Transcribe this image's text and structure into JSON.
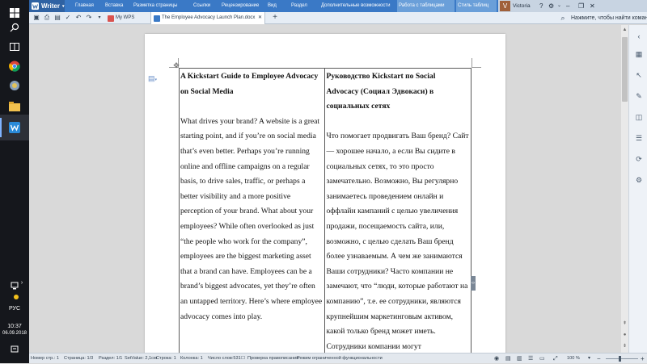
{
  "taskbar": {
    "keyboard_lang": "РУС",
    "time": "10:37",
    "date": "06.09.2018"
  },
  "ribbon": {
    "app_name": "Writer",
    "tabs": [
      "Главная",
      "Вставка",
      "Разметка страницы",
      "Ссылки",
      "Рецензирование",
      "Вид",
      "Раздел",
      "Дополнительные возможности"
    ],
    "context_tabs": [
      "Работа с таблицами",
      "Стиль таблиц"
    ],
    "user_initial": "V",
    "user_name": "Victoria"
  },
  "quick_access": {
    "doc_tabs": [
      {
        "label": "My WPS",
        "color": "#d9534f"
      },
      {
        "label": "The Employee Advocacy Launch Plan.docx",
        "color": "#3a79c6"
      }
    ],
    "help_prompt": "Нажмите, чтобы найти команды"
  },
  "document": {
    "left_title": "A Kickstart Guide to Employee Advocacy on Social Media",
    "left_body": "What drives your brand? A website is a great starting point, and if you’re on social media that’s even better. Perhaps you’re running online and offline campaigns on a regular basis, to drive sales, traffic, or perhaps a better visibility and a more positive perception of your brand. What about your employees? While often overlooked as just “the people who work for the company”, employees are the biggest marketing asset that a brand can have. Employees can be a brand’s biggest advocates, yet they’re often an untapped territory. Here’s where employee advocacy comes into play.",
    "right_title": "Руководство Kickstart по Social Advocacy (Социал Эдвокаси) в социальных сетях",
    "right_body": "Что помогает продвигать Ваш бренд? Сайт — хорошее начало, а если Вы сидите в социальных сетях, то это просто замечательно. Возможно, Вы регулярно занимаетесь проведением онлайн и оффлайн кампаний с целью увеличения продажи, посещаемость сайта, или, возможно, с целью сделать Ваш бренд более узнаваемым. А чем же занимаются Ваши сотрудники? Часто компании не замечают, что “люди, которые работают на компанию”, т.е. ее сотрудники, являются крупнейшим маркетинговым активом, какой только бренд может иметь. Сотрудники компании могут"
  },
  "status_bar": {
    "items": [
      "Номер стр.: 1",
      "Страница: 1/3",
      "Раздел: 1/1",
      "SetValue: 2,1см",
      "Строка: 1",
      "Колонка: 1",
      "Число слов:531",
      "Проверка правописания",
      "Режим ограниченной функциональности"
    ],
    "zoom": "100 %"
  }
}
